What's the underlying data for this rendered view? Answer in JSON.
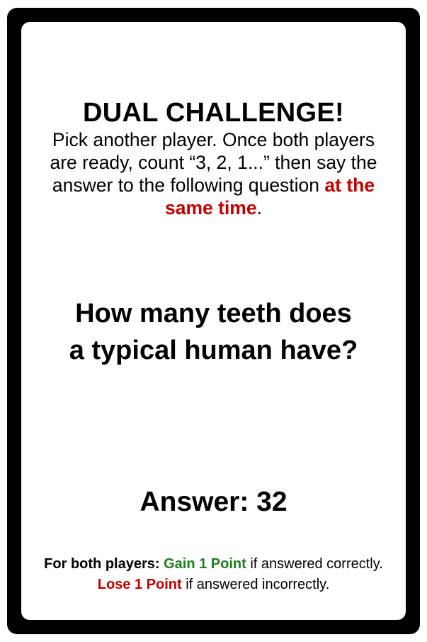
{
  "card": {
    "title": "DUAL CHALLENGE!",
    "instructions": {
      "pre": "Pick another player. Once both players are ready, count “3, 2, 1...” then say the answer to the following question ",
      "emphasis": "at the same time",
      "post": "."
    },
    "question": {
      "line1": "How many teeth does",
      "line2": "a typical human have?"
    },
    "answer": "Answer: 32",
    "rules": {
      "prefix": "For both players:",
      "gain": "Gain 1 Point",
      "gain_suffix": " if answered correctly.",
      "lose": "Lose 1 Point",
      "lose_suffix": " if answered incorrectly."
    }
  },
  "colors": {
    "border": "#000000",
    "emphasis_red": "#c40000",
    "gain_green": "#1e7d1e"
  }
}
